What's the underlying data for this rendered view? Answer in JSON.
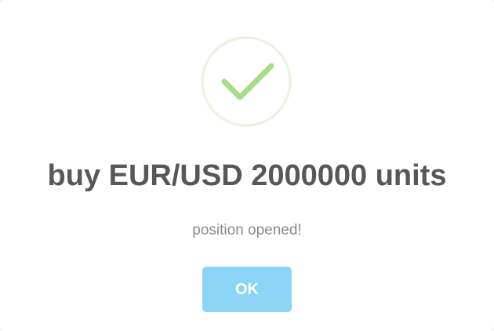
{
  "dialog": {
    "title": "buy EUR/USD 2000000 units",
    "message": "position opened!",
    "confirm_label": "OK",
    "icon": "success-checkmark-icon"
  },
  "colors": {
    "success": "#a5dc86",
    "success_ring": "#e8f4e0",
    "button": "#8cd4f5",
    "title": "#575757",
    "message": "#8b8b8b"
  }
}
